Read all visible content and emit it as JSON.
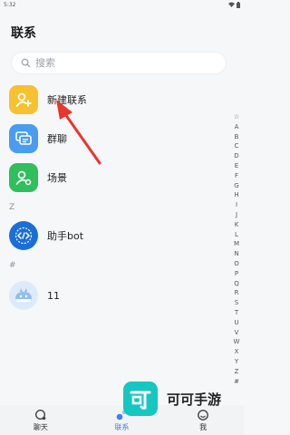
{
  "status_bar": {
    "time": "5:32"
  },
  "header": {
    "title": "联系"
  },
  "search": {
    "placeholder": "搜索"
  },
  "top_items": [
    {
      "label": "新建联系",
      "icon": "add-contact-icon",
      "color": "#f7c12f"
    },
    {
      "label": "群聊",
      "icon": "group-chat-icon",
      "color": "#4a9cf0"
    },
    {
      "label": "场景",
      "icon": "scene-icon",
      "color": "#2fbf5c"
    }
  ],
  "sections": [
    {
      "letter": "Z",
      "contacts": [
        {
          "name": "助手bot",
          "icon": "code-bot-icon"
        }
      ]
    },
    {
      "letter": "#",
      "contacts": [
        {
          "name": "11",
          "icon": "cloud-avatar-icon"
        }
      ]
    }
  ],
  "index_letters": [
    "☆",
    "A",
    "B",
    "C",
    "D",
    "E",
    "F",
    "G",
    "H",
    "I",
    "J",
    "K",
    "L",
    "M",
    "N",
    "O",
    "P",
    "Q",
    "R",
    "S",
    "T",
    "U",
    "V",
    "W",
    "X",
    "Y",
    "Z",
    "#"
  ],
  "bottom_nav": [
    {
      "label": "聊天",
      "icon": "chat-icon"
    },
    {
      "label": "联系",
      "icon": "contacts-icon",
      "active": true
    },
    {
      "label": "我",
      "icon": "profile-icon"
    }
  ],
  "watermark": {
    "logo_char": "可",
    "text": "可可手游"
  },
  "accent_color": "#3f7ef7"
}
